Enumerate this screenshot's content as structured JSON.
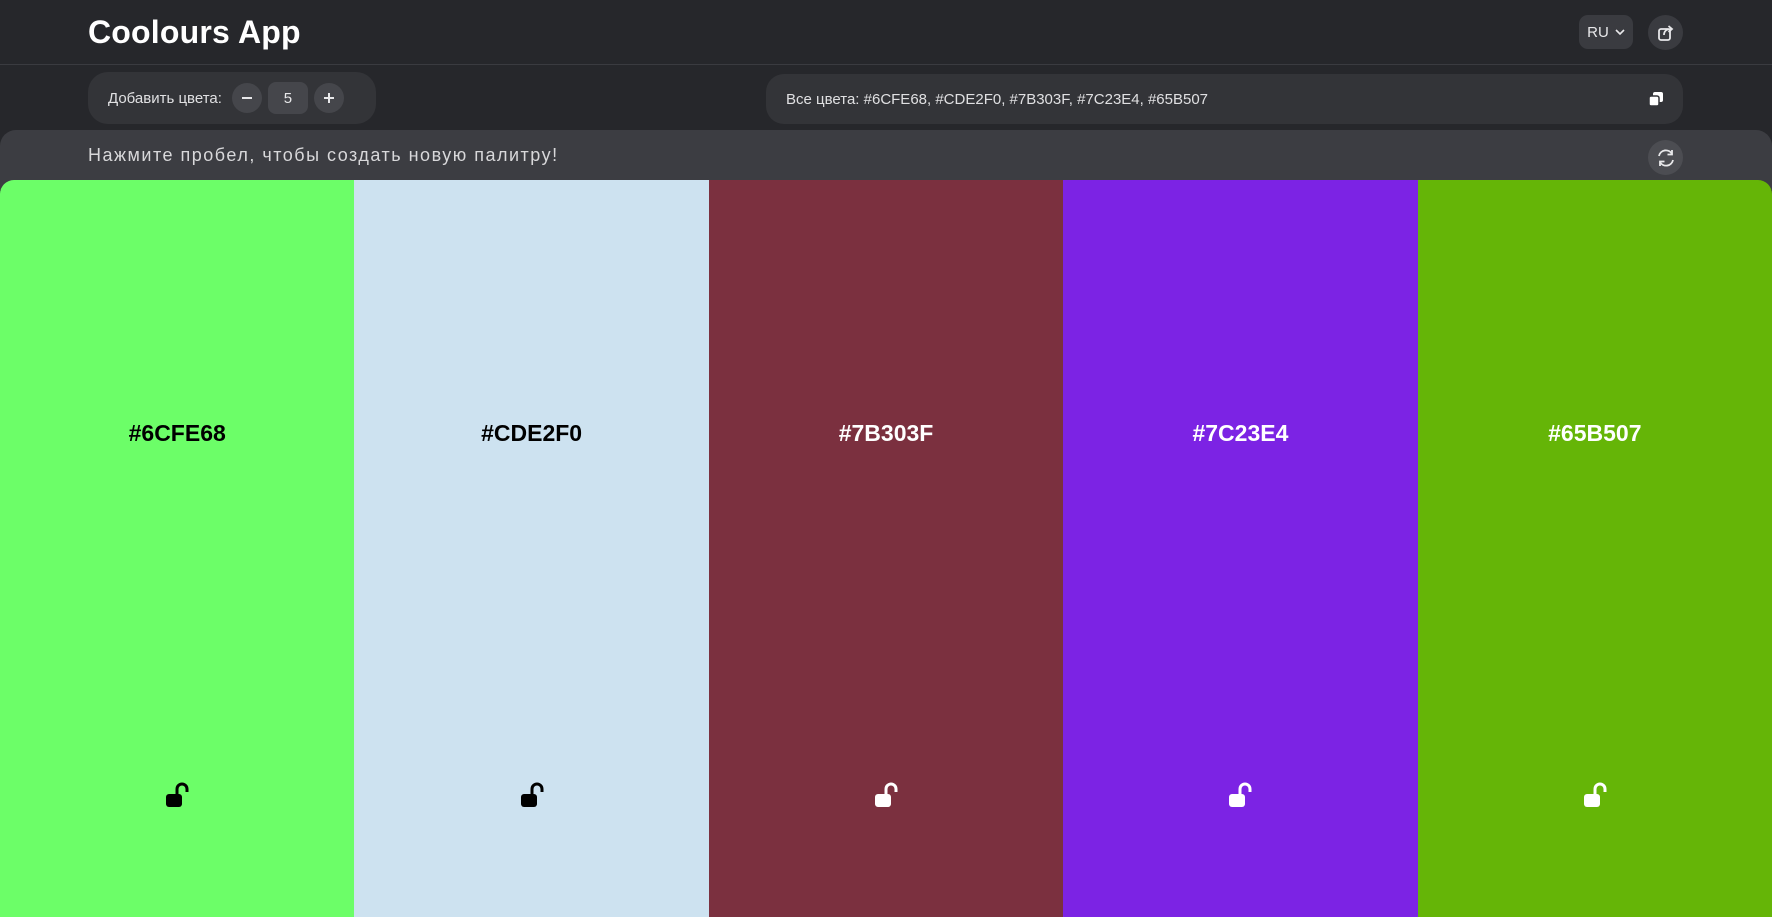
{
  "app": {
    "title": "Coolours App"
  },
  "header": {
    "language": "RU",
    "share_icon": "share-icon",
    "chevron_icon": "chevron-down-icon"
  },
  "adder": {
    "label": "Добавить цвета:",
    "count": "5",
    "minus_icon": "minus-icon",
    "plus_icon": "plus-icon"
  },
  "all_colors": {
    "text": "Все цвета: #6CFE68, #CDE2F0, #7B303F, #7C23E4, #65B507",
    "copy_icon": "copy-icon"
  },
  "hint": {
    "text": "Нажмите пробел, чтобы создать новую палитру!",
    "refresh_icon": "refresh-icon"
  },
  "colors": [
    {
      "hex": "#6CFE68",
      "bg": "#6CFE68",
      "fg": "#000000",
      "locked": false
    },
    {
      "hex": "#CDE2F0",
      "bg": "#CDE2F0",
      "fg": "#000000",
      "locked": false
    },
    {
      "hex": "#7B303F",
      "bg": "#7B303F",
      "fg": "#ffffff",
      "locked": false
    },
    {
      "hex": "#7C23E4",
      "bg": "#7C23E4",
      "fg": "#ffffff",
      "locked": false
    },
    {
      "hex": "#65B507",
      "bg": "#65B507",
      "fg": "#ffffff",
      "locked": false
    }
  ]
}
